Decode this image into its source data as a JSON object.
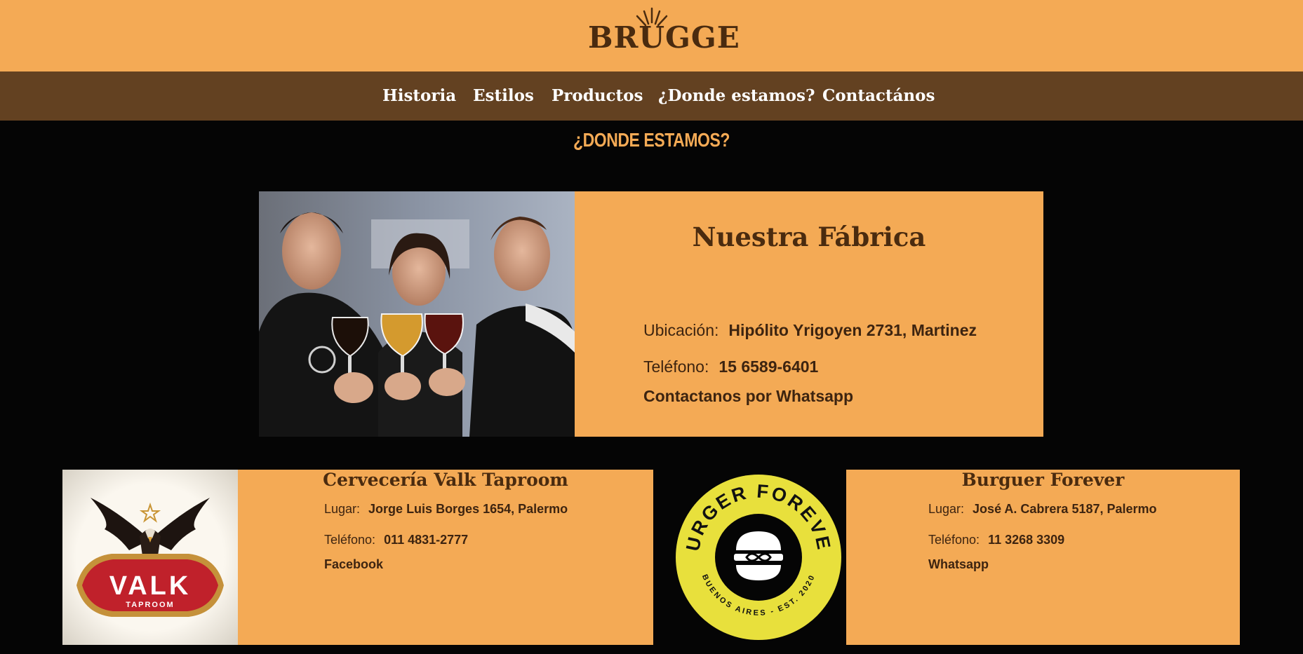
{
  "brand": {
    "name": "BRUGGE"
  },
  "nav": {
    "items": [
      {
        "label": "Historia"
      },
      {
        "label": "Estilos"
      },
      {
        "label": "Productos"
      },
      {
        "label": "¿Donde estamos?"
      },
      {
        "label": "Contactános"
      }
    ]
  },
  "section": {
    "title": "¿DONDE ESTAMOS?"
  },
  "factory": {
    "title": "Nuestra Fábrica",
    "location_label": "Ubicación:",
    "location": "Hipólito Yrigoyen 2731, Martinez",
    "phone_label": "Teléfono:",
    "phone": "15 6589-6401",
    "contact_link": "Contactanos por Whatsapp"
  },
  "places": [
    {
      "title": "Cervecería Valk Taproom",
      "place_label": "Lugar:",
      "place": "Jorge Luis Borges 1654, Palermo",
      "phone_label": "Teléfono:",
      "phone": "011 4831-2777",
      "link": "Facebook",
      "logo_text": "VALK",
      "logo_subtext": "TAPROOM"
    },
    {
      "title": "Burguer Forever",
      "place_label": "Lugar:",
      "place": "José A. Cabrera 5187, Palermo",
      "phone_label": "Teléfono:",
      "phone": "11 3268 3309",
      "link": "Whatsapp",
      "logo_text": "BURGER FOREVER",
      "logo_subtext": "BUENOS AIRES - EST. 2020"
    }
  ],
  "colors": {
    "accent": "#f4aa55",
    "nav_bg": "#634121",
    "text_dark": "#4a2b0f",
    "page_bg": "#050505"
  }
}
